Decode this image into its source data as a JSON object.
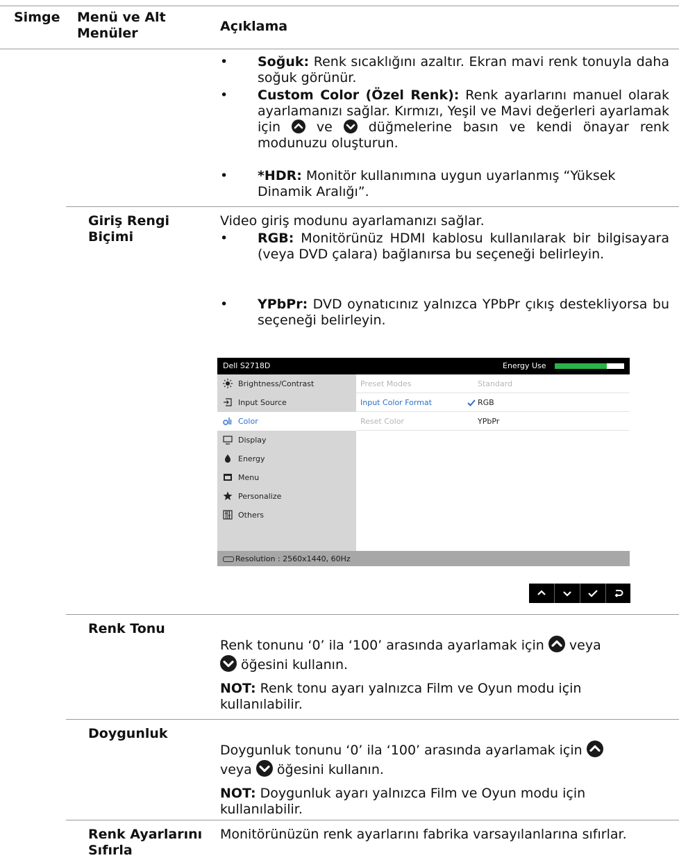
{
  "headers": {
    "icon": "Simge",
    "menu": "Menü ve Alt Menüler",
    "desc": "Açıklama"
  },
  "color_preset": {
    "cool_label": "Soğuk:",
    "cool_text": "Renk sıcaklığını azaltır. Ekran mavi renk tonuyla daha soğuk görünür.",
    "custom_label": "Custom Color (Özel Renk):",
    "custom_text_a": "Renk ayarlarını manuel olarak ayarlamanızı sağlar. Kırmızı, Yeşil ve Mavi değerleri ayarlamak için",
    "custom_text_b": "ve",
    "custom_text_c": "düğmelerine basın ve kendi önayar renk modunuzu oluşturun.",
    "hdr_label": "*HDR:",
    "hdr_text": "Monitör kullanımına uygun uyarlanmış “Yüksek Dinamik Aralığı”."
  },
  "input_color": {
    "label": "Giriş Rengi Biçimi",
    "intro": "Video giriş modunu ayarlamanızı sağlar.",
    "rgb_label": "RGB:",
    "rgb_text": "Monitörünüz HDMI kablosu kullanılarak bir bilgisayara (veya DVD çalara) bağlanırsa bu seçeneği belirleyin.",
    "ypbpr_label": "YPbPr:",
    "ypbpr_text": "DVD oynatıcınız yalnızca YPbPr çıkış destekliyorsa bu seçeneği belirleyin."
  },
  "osd": {
    "title": "Dell S2718D",
    "energy_label": "Energy Use",
    "energy_level": 0.75,
    "menu": [
      {
        "label": "Brightness/Contrast",
        "icon": "brightness-icon"
      },
      {
        "label": "Input Source",
        "icon": "input-source-icon"
      },
      {
        "label": "Color",
        "icon": "color-icon"
      },
      {
        "label": "Display",
        "icon": "display-icon"
      },
      {
        "label": "Energy",
        "icon": "energy-icon"
      },
      {
        "label": "Menu",
        "icon": "menu-icon"
      },
      {
        "label": "Personalize",
        "icon": "star-icon"
      },
      {
        "label": "Others",
        "icon": "others-icon"
      }
    ],
    "rows": [
      {
        "key": "Preset Modes",
        "value": "Standard"
      },
      {
        "key": "Input Color Format",
        "value": "RGB"
      },
      {
        "key": "Reset Color",
        "value": "YPbPr"
      }
    ],
    "resolution": "Resolution : 2560x1440, 60Hz"
  },
  "hue": {
    "label": "Renk Tonu",
    "text_a": "Renk tonunu ‘0’ ila ‘100’ arasında ayarlamak için",
    "text_b": "veya",
    "text_c": "öğesini kullanın.",
    "note_label": "NOT:",
    "note_text": "Renk tonu ayarı yalnızca Film ve Oyun modu için kullanılabilir."
  },
  "saturation": {
    "label": "Doygunluk",
    "text_a": "Doygunluk tonunu ‘0’ ila ‘100’ arasında ayarlamak için",
    "text_b": "veya",
    "text_c": "öğesini kullanın.",
    "note_label": "NOT:",
    "note_text": "Doygunluk ayarı yalnızca Film ve Oyun modu için kullanılabilir."
  },
  "reset": {
    "label": "Renk Ayarlarını Sıfırla",
    "text": "Monitörünüzün renk ayarlarını fabrika varsayılanlarına sıfırlar."
  }
}
